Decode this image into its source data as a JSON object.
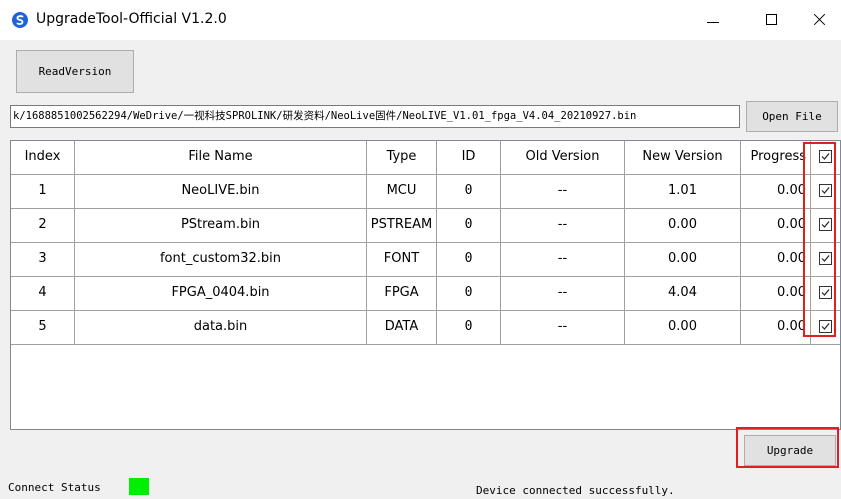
{
  "window": {
    "title": "UpgradeTool-Official V1.2.0"
  },
  "toolbar": {
    "read_version_label": "ReadVersion",
    "open_file_label": "Open File",
    "file_path": "k/1688851002562294/WeDrive/一视科技SPROLINK/研发资料/NeoLive固件/NeoLIVE_V1.01_fpga_V4.04_20210927.bin"
  },
  "table": {
    "headers": [
      "Index",
      "File Name",
      "Type",
      "ID",
      "Old Version",
      "New Version",
      "Progress"
    ],
    "rows": [
      {
        "index": "1",
        "file": "NeoLIVE.bin",
        "type": "MCU",
        "id": "0",
        "old": "--",
        "new": "1.01",
        "progress": "0.00",
        "checked": true
      },
      {
        "index": "2",
        "file": "PStream.bin",
        "type": "PSTREAM",
        "id": "0",
        "old": "--",
        "new": "0.00",
        "progress": "0.00",
        "checked": true
      },
      {
        "index": "3",
        "file": "font_custom32.bin",
        "type": "FONT",
        "id": "0",
        "old": "--",
        "new": "0.00",
        "progress": "0.00",
        "checked": true
      },
      {
        "index": "4",
        "file": "FPGA_0404.bin",
        "type": "FPGA",
        "id": "0",
        "old": "--",
        "new": "4.04",
        "progress": "0.00",
        "checked": true
      },
      {
        "index": "5",
        "file": "data.bin",
        "type": "DATA",
        "id": "0",
        "old": "--",
        "new": "0.00",
        "progress": "0.00",
        "checked": true
      }
    ],
    "header_checked": true
  },
  "actions": {
    "upgrade_label": "Upgrade"
  },
  "status": {
    "label": "Connect Status",
    "led_color": "#00ee00",
    "message": "Device connected successfully."
  },
  "icons": {
    "app": "app-logo-icon",
    "minimize": "minimize-icon",
    "maximize": "maximize-icon",
    "close": "close-icon"
  },
  "colors": {
    "highlight": "#e02020"
  }
}
